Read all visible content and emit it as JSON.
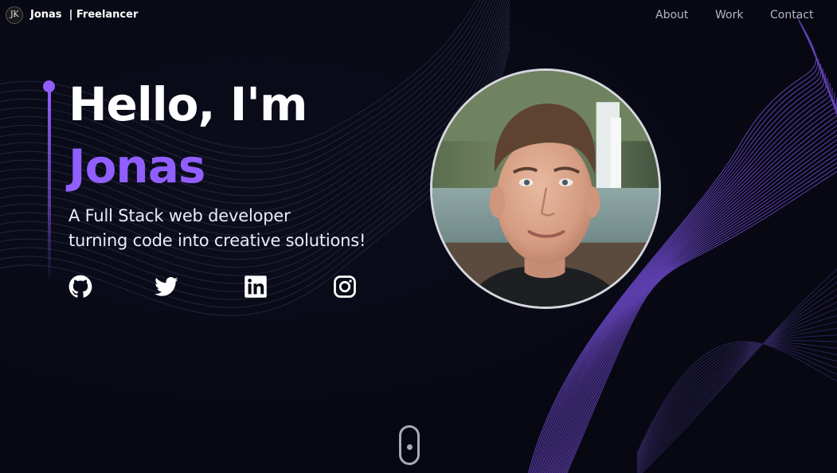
{
  "header": {
    "logo_text": "JK",
    "brand": "Jonas  | Freelancer",
    "nav": {
      "about": "About",
      "work": "Work",
      "contact": "Contact"
    }
  },
  "hero": {
    "greeting": "Hello, I'm",
    "name": "Jonas",
    "subtitle_line1": "A Full Stack web developer",
    "subtitle_line2": "turning code into creative solutions!"
  },
  "socials": [
    {
      "icon": "github-icon"
    },
    {
      "icon": "twitter-icon"
    },
    {
      "icon": "linkedin-icon"
    },
    {
      "icon": "instagram-icon"
    }
  ],
  "colors": {
    "background": "#070812",
    "accent": "#915eff",
    "text": "#ffffff",
    "nav_text": "#b4b6c4"
  }
}
